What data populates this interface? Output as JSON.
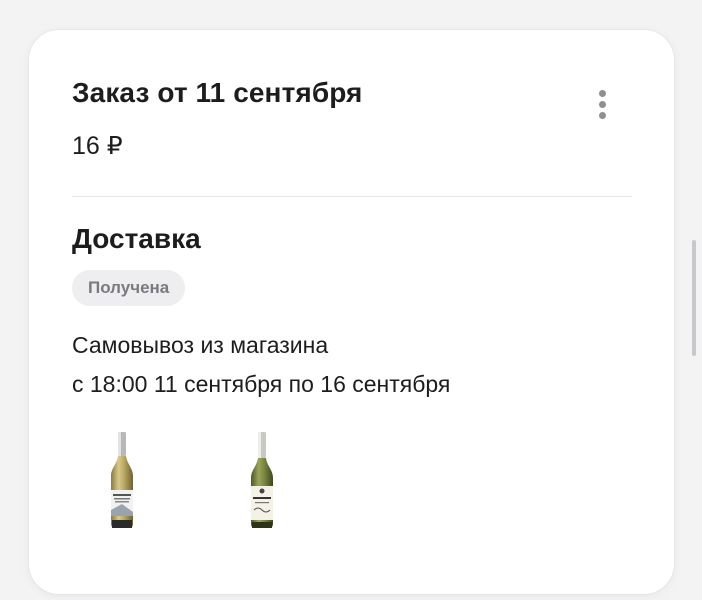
{
  "order": {
    "title": "Заказ от 11 сентября",
    "price": "16 ₽"
  },
  "delivery": {
    "title": "Доставка",
    "status": "Получена",
    "method": "Самовывоз из магазина",
    "time_window": "с 18:00 11 сентября по 16 сентября"
  },
  "products": [
    {
      "icon": "wine-bottle-icon"
    },
    {
      "icon": "wine-bottle-icon"
    }
  ],
  "colors": {
    "background": "#f3f3f4",
    "card": "#ffffff",
    "badge_bg": "#eeeef0",
    "badge_text": "#7a7a80"
  }
}
